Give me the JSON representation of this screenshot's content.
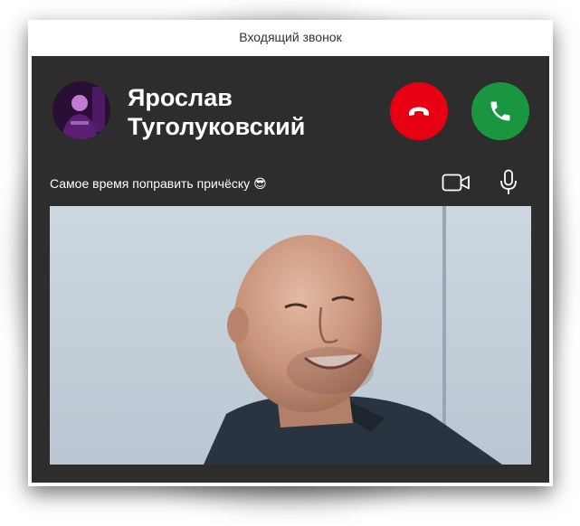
{
  "window": {
    "title": "Входящий звонок"
  },
  "caller": {
    "first_name": "Ярослав",
    "last_name": "Туголуковский"
  },
  "status": {
    "message": "Самое время поправить причёску",
    "emoji": "😎"
  },
  "icons": {
    "decline": "phone-hangup-icon",
    "accept": "phone-icon",
    "camera": "video-camera-icon",
    "microphone": "microphone-icon"
  },
  "colors": {
    "panel_bg": "#2d2d2d",
    "decline": "#e60012",
    "accept": "#1a9641",
    "text": "#ffffff"
  }
}
